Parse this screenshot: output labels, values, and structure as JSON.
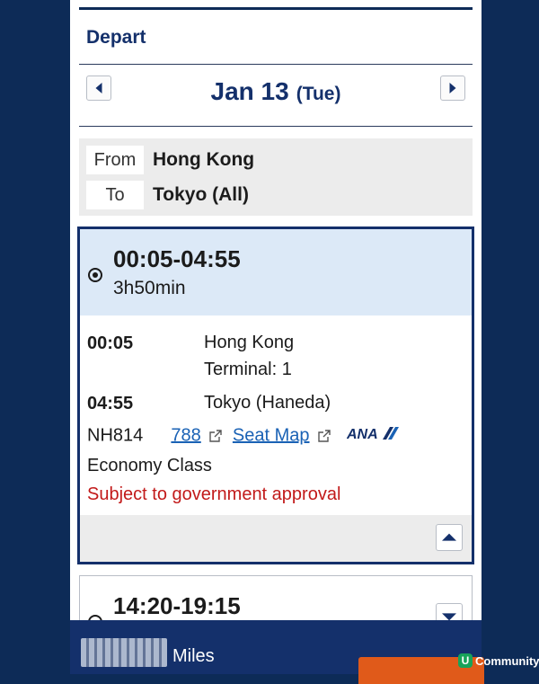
{
  "depart": {
    "title": "Depart",
    "date": "Jan 13",
    "day_of_week": "(Tue)"
  },
  "route": {
    "from_label": "From",
    "from_value": "Hong Kong",
    "to_label": "To",
    "to_value": "Tokyo (All)"
  },
  "flights": [
    {
      "time_range": "00:05-04:55",
      "duration": "3h50min",
      "departure_time": "00:05",
      "departure_place": "Hong Kong",
      "departure_terminal": "Terminal: 1",
      "arrival_time": "04:55",
      "arrival_place": "Tokyo (Haneda)",
      "flight_number": "NH814",
      "aircraft_link": "788",
      "seat_map_link": "Seat Map",
      "airline_logo_text": "ANA",
      "cabin": "Economy Class",
      "notice": "Subject to government approval"
    },
    {
      "time_range": "14:20-19:15"
    }
  ],
  "footer": {
    "miles_label": "Miles",
    "community_badge": "U",
    "community_text": "Community"
  },
  "colors": {
    "navy": "#14306b",
    "background": "#0d2b57",
    "link": "#1a62b5",
    "warning": "#c21a1a",
    "next_button": "#e05a1a"
  }
}
